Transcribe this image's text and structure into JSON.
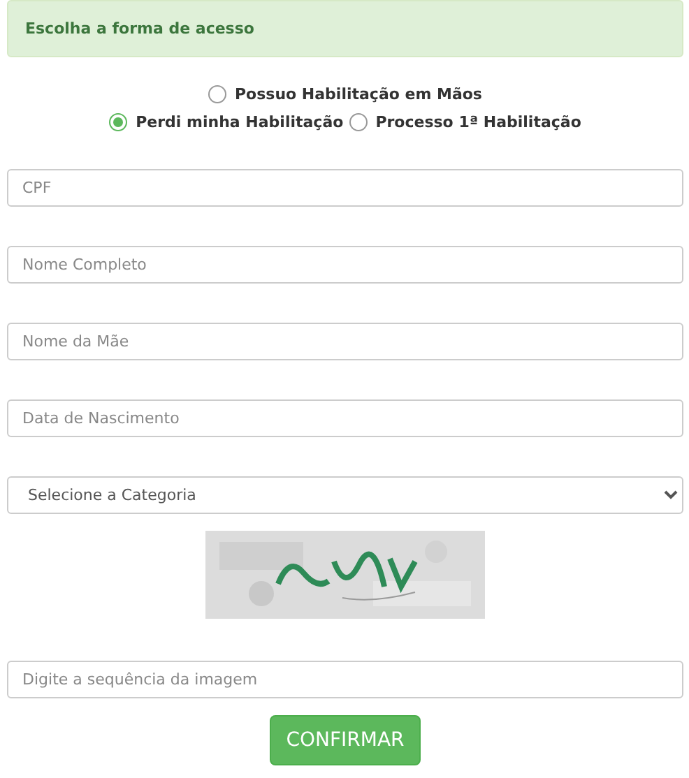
{
  "header": {
    "title": "Escolha a forma de acesso"
  },
  "access_options": [
    {
      "label": "Possuo Habilitação em Mãos",
      "selected": false
    },
    {
      "label": "Perdi minha Habilitação",
      "selected": true
    },
    {
      "label": "Processo 1ª Habilitação",
      "selected": false
    }
  ],
  "fields": [
    {
      "kind": "text",
      "placeholder": "CPF"
    },
    {
      "kind": "text",
      "placeholder": "Nome Completo"
    },
    {
      "kind": "text",
      "placeholder": "Nome da Mãe"
    },
    {
      "kind": "text",
      "placeholder": "Data de Nascimento"
    },
    {
      "kind": "select",
      "value": "Selecione a Categoria"
    }
  ],
  "captcha_answer": {
    "placeholder": "Digite a sequência da imagem"
  },
  "submit_button": {
    "label": "CONFIRMAR"
  }
}
